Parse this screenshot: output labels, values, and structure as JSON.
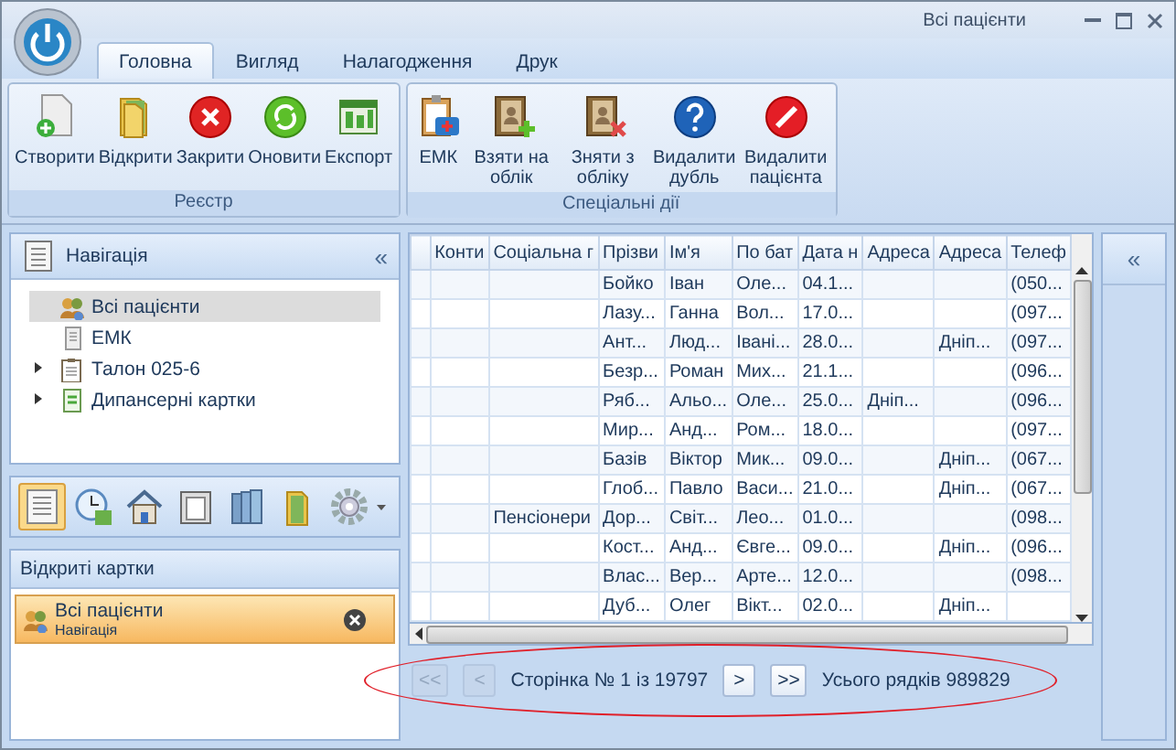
{
  "window": {
    "title": "Всі пацієнти"
  },
  "tabs": [
    {
      "label": "Головна",
      "selected": true
    },
    {
      "label": "Вигляд",
      "selected": false
    },
    {
      "label": "Налагодження",
      "selected": false
    },
    {
      "label": "Друк",
      "selected": false
    }
  ],
  "ribbon_groups": [
    {
      "label": "Реєстр",
      "buttons": [
        {
          "label": "Створити"
        },
        {
          "label": "Відкрити"
        },
        {
          "label": "Закрити"
        },
        {
          "label": "Оновити"
        },
        {
          "label": "Експорт"
        }
      ]
    },
    {
      "label": "Спеціальні дії",
      "buttons": [
        {
          "label": "ЕМК"
        },
        {
          "label": "Взяти на облік"
        },
        {
          "label": "Зняти з обліку"
        },
        {
          "label": "Видалити дубль"
        },
        {
          "label": "Видалити пацієнта"
        }
      ]
    }
  ],
  "navigation": {
    "title": "Навігація",
    "collapse": "«",
    "items": [
      {
        "label": "Всі пацієнти",
        "selected": true
      },
      {
        "label": "ЕМК",
        "selected": false
      },
      {
        "label": "Талон 025-6",
        "selected": false,
        "expanded": false
      },
      {
        "label": "Дипансерні картки",
        "selected": false,
        "expanded": false
      }
    ]
  },
  "nav_toolbar": [
    {
      "selected": true
    },
    {
      "selected": false
    },
    {
      "selected": false
    },
    {
      "selected": false
    },
    {
      "selected": false
    },
    {
      "selected": false
    },
    {
      "selected": false
    }
  ],
  "open_cards": {
    "title": "Відкриті картки",
    "items": [
      {
        "title": "Всі пацієнти",
        "subtitle": "Навігація",
        "selected": true
      }
    ]
  },
  "table": {
    "columns": [
      "Конти",
      "Соціальна г",
      "Прізви",
      "Ім'я",
      "По бат",
      "Дата н",
      "Адреса",
      "Адреса",
      "Телеф"
    ],
    "rows": [
      [
        null,
        null,
        "Бойко",
        "Іван",
        "Оле...",
        "04.1...",
        null,
        null,
        "(050..."
      ],
      [
        null,
        null,
        "Лазу...",
        "Ганна",
        "Вол...",
        "17.0...",
        null,
        null,
        "(097..."
      ],
      [
        null,
        null,
        "Ант...",
        "Люд...",
        "Івані...",
        "28.0...",
        null,
        "Дніп...",
        "(097..."
      ],
      [
        null,
        null,
        "Безр...",
        "Роман",
        "Мих...",
        "21.1...",
        null,
        null,
        "(096..."
      ],
      [
        null,
        null,
        "Ряб...",
        "Альо...",
        "Оле...",
        "25.0...",
        "Дніп...",
        null,
        "(096..."
      ],
      [
        null,
        null,
        "Мир...",
        "Анд...",
        "Ром...",
        "18.0...",
        null,
        null,
        "(097..."
      ],
      [
        null,
        null,
        "Базів",
        "Віктор",
        "Мик...",
        "09.0...",
        null,
        "Дніп...",
        "(067..."
      ],
      [
        null,
        null,
        "Глоб...",
        "Павло",
        "Васи...",
        "21.0...",
        null,
        "Дніп...",
        "(067..."
      ],
      [
        null,
        "Пенсіонери",
        "Дор...",
        "Світ...",
        "Лео...",
        "01.0...",
        null,
        null,
        "(098..."
      ],
      [
        null,
        null,
        "Кост...",
        "Анд...",
        "Євге...",
        "09.0...",
        null,
        "Дніп...",
        "(096..."
      ],
      [
        null,
        null,
        "Влас...",
        "Вер...",
        "Арте...",
        "12.0...",
        null,
        null,
        "(098..."
      ],
      [
        null,
        null,
        "Дуб...",
        "Олег",
        "Вікт...",
        "02.0...",
        null,
        "Дніп...",
        null
      ]
    ]
  },
  "pager": {
    "first": {
      "label": "<<",
      "disabled": true
    },
    "prev": {
      "label": "<",
      "disabled": true
    },
    "page_text": "Сторінка № 1 із 19797",
    "next": {
      "label": ">",
      "disabled": false
    },
    "last": {
      "label": ">>",
      "disabled": false
    },
    "total_text": "Усього рядків 989829"
  },
  "right_panel": {
    "collapse": "«"
  }
}
